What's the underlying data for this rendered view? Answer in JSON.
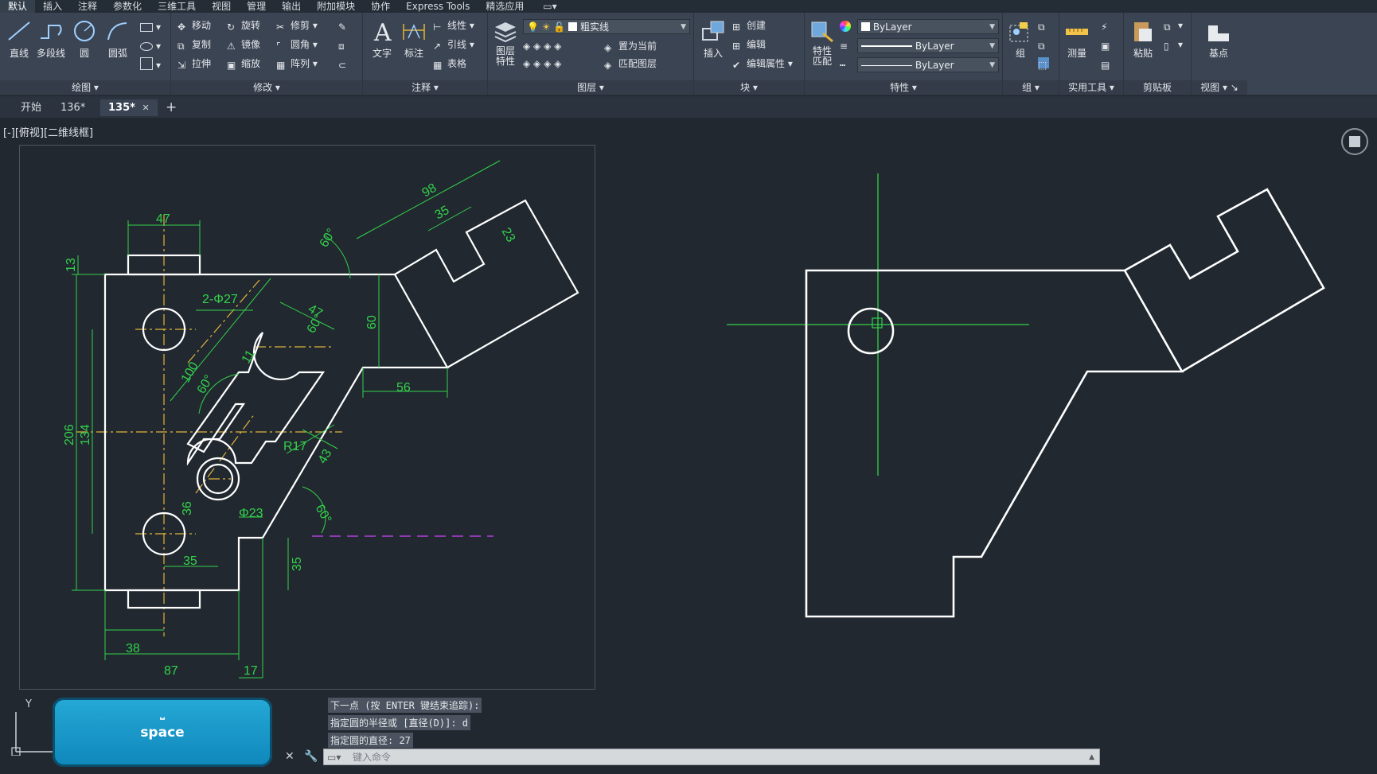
{
  "menu": {
    "items": [
      "默认",
      "插入",
      "注释",
      "参数化",
      "三维工具",
      "视图",
      "管理",
      "输出",
      "附加模块",
      "协作",
      "Express Tools",
      "精选应用"
    ],
    "active_index": 0
  },
  "ribbon": {
    "draw": {
      "title": "绘图",
      "tools": [
        "直线",
        "多段线",
        "圆",
        "圆弧"
      ]
    },
    "modify": {
      "title": "修改",
      "tools": [
        "移动",
        "旋转",
        "修剪",
        "复制",
        "镜像",
        "圆角",
        "拉伸",
        "缩放",
        "阵列"
      ]
    },
    "annotation": {
      "title": "注释",
      "big": [
        "文字",
        "标注"
      ],
      "small": [
        "线性",
        "引线",
        "表格"
      ]
    },
    "layers": {
      "title": "图层",
      "big": "图层\n特性",
      "current_layer": "粗实线",
      "small": [
        "置为当前",
        "匹配图层"
      ]
    },
    "block": {
      "title": "块",
      "big": "插入",
      "small": [
        "创建",
        "编辑",
        "编辑属性"
      ]
    },
    "properties": {
      "title": "特性",
      "big": "特性\n匹配",
      "color": "ByLayer",
      "linetype": "ByLayer",
      "lineweight": "ByLayer"
    },
    "groups": {
      "title": "组",
      "big": "组"
    },
    "utilities": {
      "title": "实用工具",
      "big": "测量"
    },
    "clipboard": {
      "title": "剪贴板",
      "big": "粘贴"
    },
    "view": {
      "title": "视图",
      "big": "基点"
    }
  },
  "tabs": [
    {
      "label": "开始"
    },
    {
      "label": "136*"
    },
    {
      "label": "135*",
      "close": "✕"
    }
  ],
  "add_tab": "+",
  "viewport_label": "[-][俯视][二维线框]",
  "drawing": {
    "dims": [
      "47",
      "13",
      "2-Φ27",
      "47",
      "60°",
      "11",
      "100",
      "60°",
      "206",
      "134",
      "R17",
      "43",
      "Φ23",
      "36",
      "35",
      "60°",
      "98",
      "35",
      "23",
      "60°",
      "60",
      "56",
      "35",
      "38",
      "87",
      "17"
    ]
  },
  "command": {
    "history": [
      "下一点 (按 ENTER 键结束追踪):",
      "指定圆的半径或 [直径(D)]: d",
      "指定圆的直径: 27"
    ],
    "placeholder": "键入命令"
  },
  "keycast": {
    "glyph": "⎵",
    "label": "space"
  },
  "ucs": {
    "y_label": "Y"
  },
  "colors": {
    "background": "#212830",
    "geometry": "#ffffff",
    "dimension": "#33d24a",
    "centerline": "#e0b43a",
    "hidden": "#b23fd8",
    "ribbon": "#3b4453"
  }
}
